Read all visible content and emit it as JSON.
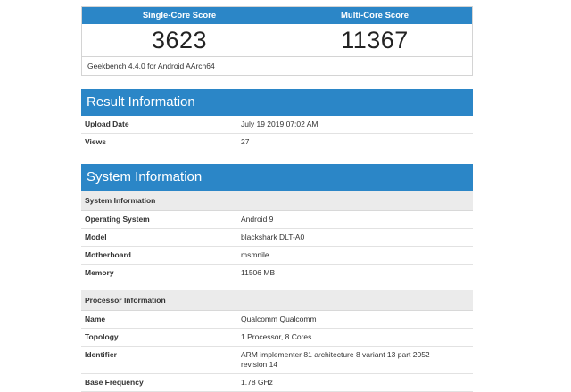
{
  "scores": {
    "single_label": "Single-Core Score",
    "single_value": "3623",
    "multi_label": "Multi-Core Score",
    "multi_value": "11367",
    "version": "Geekbench 4.4.0 for Android AArch64"
  },
  "result": {
    "title": "Result Information",
    "rows": [
      {
        "key": "Upload Date",
        "value": "July 19 2019 07:02 AM"
      },
      {
        "key": "Views",
        "value": "27"
      }
    ]
  },
  "system": {
    "title": "System Information",
    "system_sub": "System Information",
    "system_rows": [
      {
        "key": "Operating System",
        "value": "Android 9"
      },
      {
        "key": "Model",
        "value": "blackshark DLT-A0"
      },
      {
        "key": "Motherboard",
        "value": "msmnile"
      },
      {
        "key": "Memory",
        "value": "11506 MB"
      }
    ],
    "processor_sub": "Processor Information",
    "processor_rows": [
      {
        "key": "Name",
        "value": "Qualcomm Qualcomm"
      },
      {
        "key": "Topology",
        "value": "1 Processor, 8 Cores"
      },
      {
        "key": "Identifier",
        "value": "ARM implementer 81 architecture 8 variant 13 part 2052 revision 14"
      },
      {
        "key": "Base Frequency",
        "value": "1.78 GHz"
      }
    ]
  },
  "colors": {
    "header_blue": "#2b86c7",
    "subheader_gray": "#ebebeb"
  }
}
